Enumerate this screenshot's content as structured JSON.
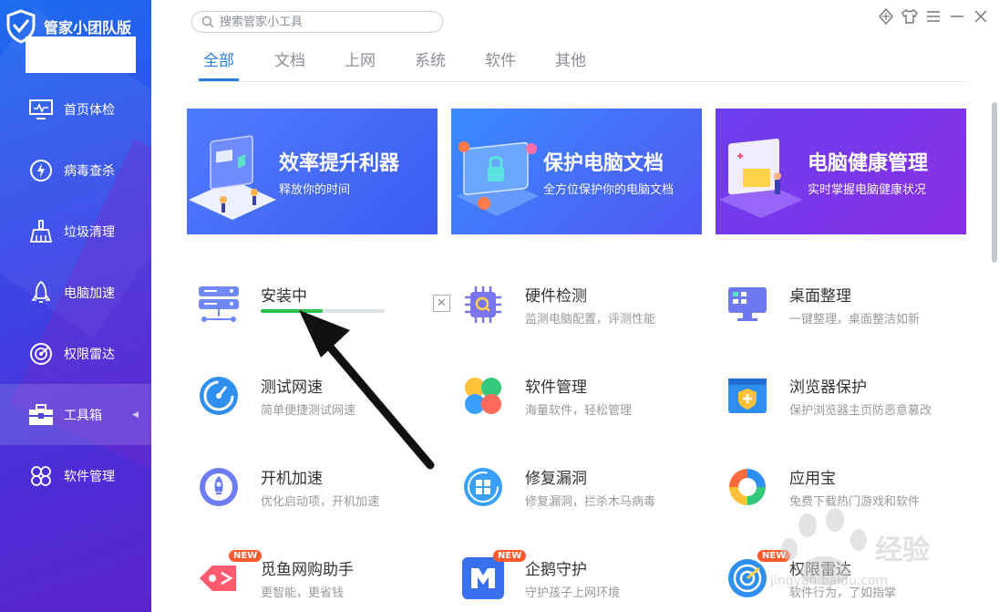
{
  "app": {
    "title": "管家小团队版"
  },
  "sidebar": {
    "items": [
      {
        "label": "首页体检",
        "icon": "monitor-icon",
        "active": false
      },
      {
        "label": "病毒查杀",
        "icon": "lightning-icon",
        "active": false
      },
      {
        "label": "垃圾清理",
        "icon": "broom-icon",
        "active": false
      },
      {
        "label": "电脑加速",
        "icon": "rocket-icon",
        "active": false
      },
      {
        "label": "权限雷达",
        "icon": "radar-icon",
        "active": false
      },
      {
        "label": "工具箱",
        "icon": "toolbox-icon",
        "active": true
      },
      {
        "label": "软件管理",
        "icon": "clover-icon",
        "active": false
      }
    ]
  },
  "search": {
    "placeholder": "搜索管家小工具"
  },
  "tabs": [
    {
      "label": "全部",
      "active": true
    },
    {
      "label": "文档",
      "active": false
    },
    {
      "label": "上网",
      "active": false
    },
    {
      "label": "系统",
      "active": false
    },
    {
      "label": "软件",
      "active": false
    },
    {
      "label": "其他",
      "active": false
    }
  ],
  "banners": [
    {
      "title": "效率提升利器",
      "subtitle": "释放你的时间"
    },
    {
      "title": "保护电脑文档",
      "subtitle": "全方位保护你的电脑文档"
    },
    {
      "title": "电脑健康管理",
      "subtitle": "实时掌握电脑健康状况"
    }
  ],
  "tools": {
    "installing": {
      "status": "安装中",
      "progress": 0.5
    },
    "hardware": {
      "name": "硬件检测",
      "desc": "监测电脑配置，评测性能"
    },
    "desktop": {
      "name": "桌面整理",
      "desc": "一键整理，桌面整洁如新"
    },
    "speedtest": {
      "name": "测试网速",
      "desc": "简单便捷测试网速"
    },
    "software": {
      "name": "软件管理",
      "desc": "海量软件，轻松管理"
    },
    "browser": {
      "name": "浏览器保护",
      "desc": "保护浏览器主页防恶意篡改"
    },
    "boot": {
      "name": "开机加速",
      "desc": "优化启动项，开机加速"
    },
    "repair": {
      "name": "修复漏洞",
      "desc": "修复漏洞，拦杀木马病毒"
    },
    "appstore": {
      "name": "应用宝",
      "desc": "免费下载热门游戏和软件"
    },
    "shopping": {
      "name": "觅鱼网购助手",
      "desc": "更智能，更省钱",
      "badge": "NEW"
    },
    "guardian": {
      "name": "企鹅守护",
      "desc": "守护孩子上网环境",
      "badge": "NEW"
    },
    "radar": {
      "name": "权限雷达",
      "desc": "软件行为，了如指掌",
      "badge": "NEW"
    }
  },
  "watermark": {
    "text": "经验",
    "url": "jingyan.baidu.com"
  },
  "colors": {
    "accent": "#2b7be4",
    "progress": "#2fbf4f",
    "badge": "#ff5a2c"
  }
}
